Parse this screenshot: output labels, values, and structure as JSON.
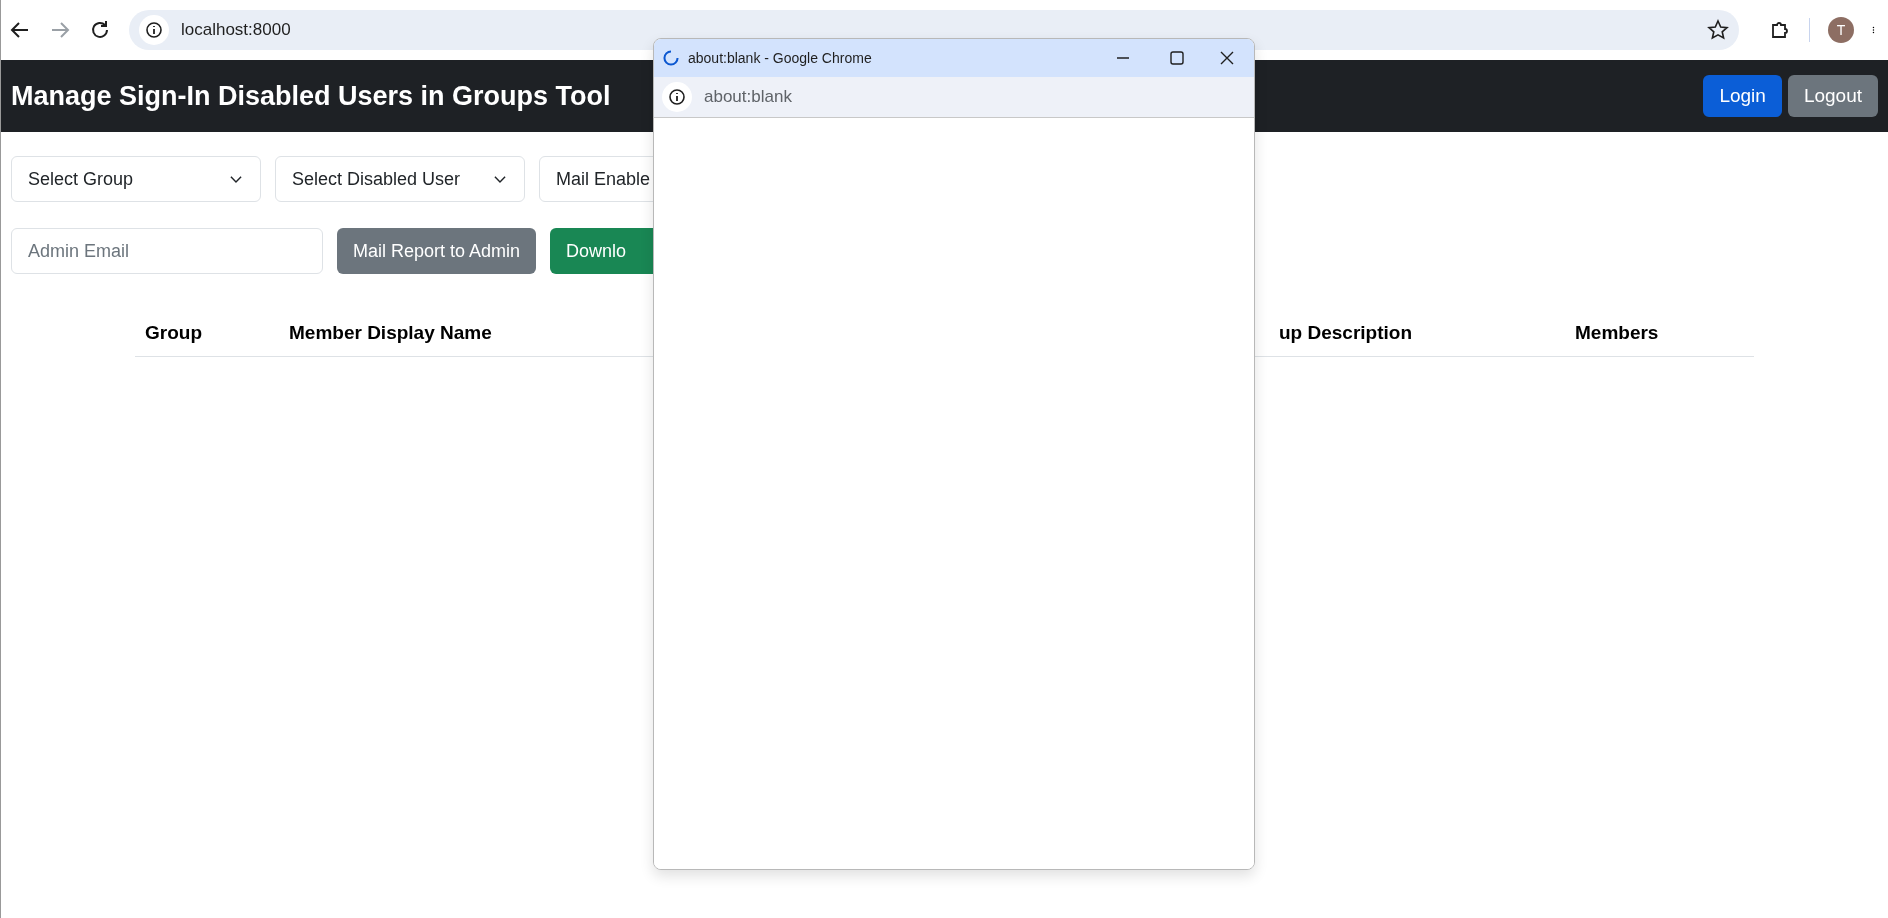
{
  "browser": {
    "url": "localhost:8000",
    "avatar": "T"
  },
  "header": {
    "title": "Manage Sign-In Disabled Users in Groups Tool",
    "buttons": [
      {
        "label": "Login",
        "kind": "primary"
      },
      {
        "label": "Logout",
        "kind": "secondary"
      }
    ]
  },
  "filters": [
    {
      "value": "Select Group"
    },
    {
      "value": "Select Disabled User"
    },
    {
      "value": "Mail Enable"
    }
  ],
  "admin_email": {
    "placeholder": "Admin Email"
  },
  "actions": [
    {
      "label": "Mail Report to Admin",
      "kind": "secondary"
    },
    {
      "label": "Downlo",
      "kind": "success"
    }
  ],
  "table": {
    "columns": [
      "Group",
      "Member Display Name",
      "up Description",
      "Members"
    ]
  },
  "popup": {
    "title": "about:blank - Google Chrome",
    "url": "about:blank"
  }
}
